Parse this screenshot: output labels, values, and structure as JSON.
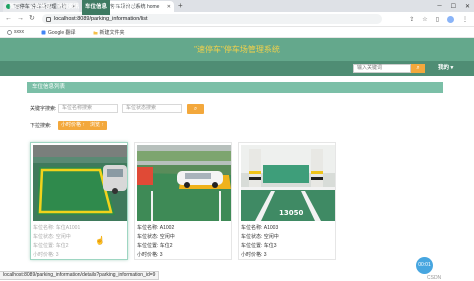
{
  "browser": {
    "tabs": [
      {
        "title": "\"速停车\"停车场管理系统"
      },
      {
        "title": "\"速停车\"停车场管理系统 home"
      }
    ],
    "new_tab": "+",
    "window_controls": {
      "minimize": "─",
      "maximize": "☐",
      "close": "✕"
    },
    "url": "localhost:8089/parking_information/list",
    "bookmarks": [
      {
        "label": "sxxx"
      },
      {
        "label": "Google 翻译"
      },
      {
        "label": "新建文件夹"
      }
    ],
    "status_url": "localhost:8089/parking_information/details?parking_information_id=9"
  },
  "site": {
    "title": "\"速停车\"停车场管理系统",
    "nav": [
      "首页",
      "公告信息",
      "新闻资讯",
      "车位信息",
      "积分兑换"
    ],
    "nav_active_index": 3,
    "search_placeholder": "输入关键词",
    "search_icon": "search-icon",
    "mine_label": "我的",
    "accent_color": "#f3a83c",
    "header_color": "#64a88c",
    "nav_color": "#4f8d74"
  },
  "page": {
    "section_title": "车位信息列表",
    "keyword_label": "关键字搜索:",
    "name_placeholder": "车位名称搜索",
    "status_placeholder": "车位状态搜索",
    "sort_label": "下拉搜索:",
    "sort_buttons": [
      "小时价格 ↑",
      "浏览 ↑"
    ]
  },
  "cards": [
    {
      "name": "车位名称: 车位A1001",
      "status": "车位状态: 空闲中",
      "location": "车位位置: 车位2",
      "price": "小时价格: 3",
      "photo": "green-parking-space-photo"
    },
    {
      "name": "车位名称: A1002",
      "status": "车位状态: 空闲中",
      "location": "车位位置: 车位2",
      "price": "小时价格: 3",
      "photo": "parking-lot-cars-photo"
    },
    {
      "name": "车位名称: A1003",
      "status": "车位状态: 空闲中",
      "location": "车位位置: 车位3",
      "price": "小时价格: 3",
      "photo": "underground-garage-photo"
    }
  ],
  "garage_floor_number": "13050",
  "float_button": "00:01",
  "watermark": "CSDN"
}
